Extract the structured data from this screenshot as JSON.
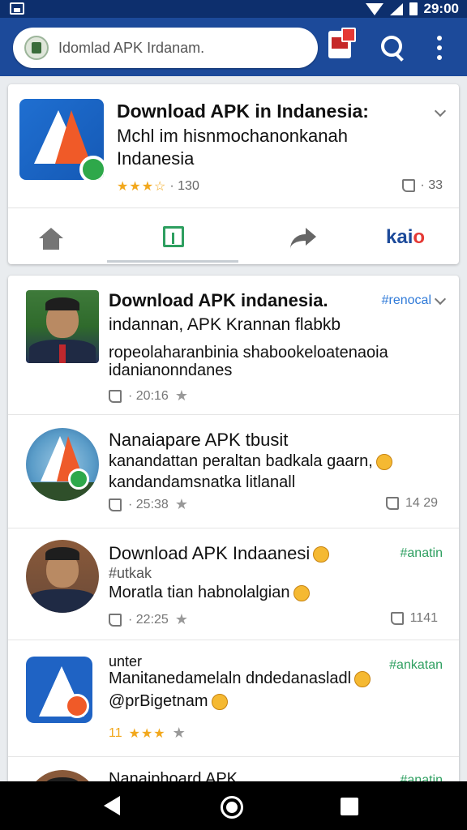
{
  "status_bar": {
    "time": "29:00"
  },
  "search": {
    "text": "Idomlad APK Irdanam."
  },
  "top_card": {
    "title": "Download APK in Indanesia:",
    "subtitle": "Mchl im hisnmochanonkanah Indanesia",
    "stars": "★★★☆",
    "rating_count": "· 130",
    "likes": "· 33",
    "brand": "kai",
    "brand_accent": "o"
  },
  "posts": [
    {
      "title": "Download APK indanesia.",
      "tag": "#renocal",
      "line1": "indannan, APK Krannan flabkb",
      "line2": "ropeolaharanbinia shabookeloatenaoia",
      "line3": "idanianonndanes",
      "time": "· 20:16"
    },
    {
      "title": "Nanaiapare APK tbusit",
      "line1": "kanandattan peraltan badkala gaarn,",
      "line2": "kandandamsnatka litlanall",
      "time": "· 25:38",
      "likes": "14 29"
    },
    {
      "title": "Download APK Indaanesi",
      "tag": "#anatin",
      "line1": "#utkak",
      "line2": "Moratla tian habnolalgian",
      "time": "· 22:25",
      "likes": "1141"
    },
    {
      "title": "unter",
      "tag": "#ankatan",
      "line1": "Manitanedamelaln dndedanasladl",
      "line2": "@prBigetnam",
      "rating_prefix": "11",
      "stars": "★★★"
    },
    {
      "title": "Nanaiphoard APK",
      "tag": "#anatin"
    }
  ],
  "colors": {
    "appbar": "#1c4a9a",
    "status_bar": "#0d2f6d",
    "star": "#f2a81d",
    "tag_blue": "#2f7ad8",
    "tag_green": "#2e9f60"
  }
}
